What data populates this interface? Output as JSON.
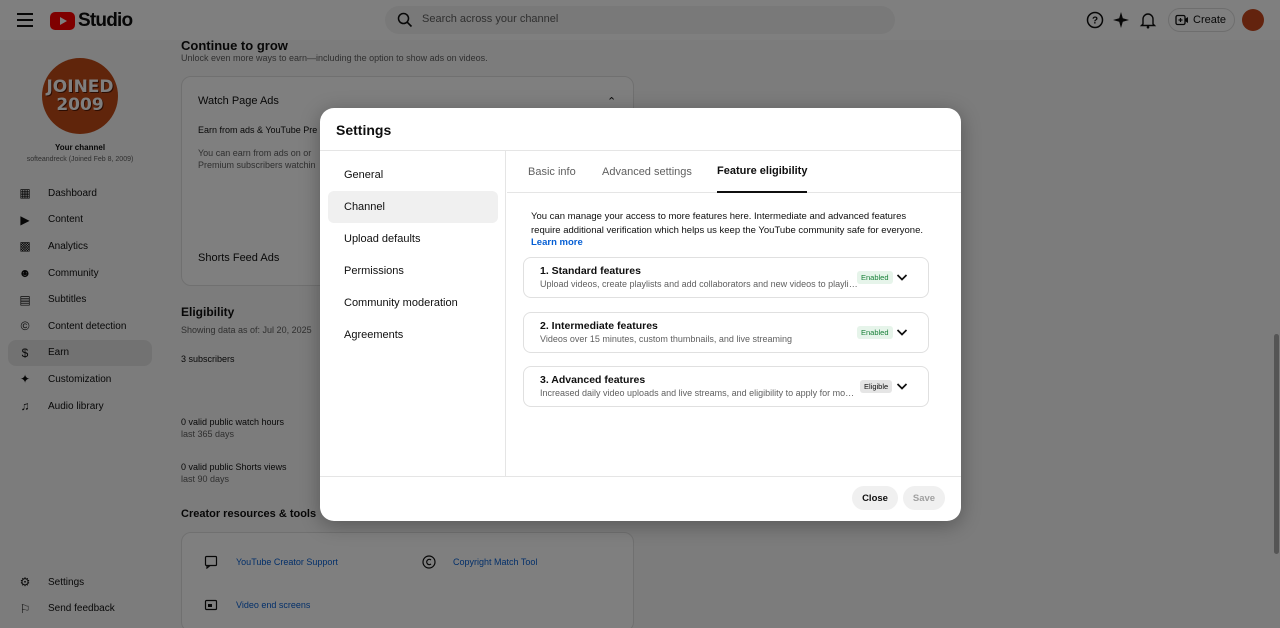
{
  "app": {
    "logo_text": "Studio",
    "search_placeholder": "Search across your channel",
    "create_label": "Create"
  },
  "channel": {
    "avatar_line1": "JOINED",
    "avatar_line2": "2009",
    "your_channel": "Your channel",
    "subtitle": "softeandreck (Joined Feb 8, 2009)"
  },
  "sidebar": {
    "items": [
      {
        "label": "Dashboard",
        "icon": "dashboard-icon"
      },
      {
        "label": "Content",
        "icon": "content-icon"
      },
      {
        "label": "Analytics",
        "icon": "analytics-icon"
      },
      {
        "label": "Community",
        "icon": "community-icon"
      },
      {
        "label": "Subtitles",
        "icon": "subtitles-icon"
      },
      {
        "label": "Content detection",
        "icon": "copyright-icon"
      },
      {
        "label": "Earn",
        "icon": "dollar-icon"
      },
      {
        "label": "Customization",
        "icon": "magic-wand-icon"
      },
      {
        "label": "Audio library",
        "icon": "audio-library-icon"
      }
    ],
    "bottom": [
      {
        "label": "Settings",
        "icon": "gear-icon"
      },
      {
        "label": "Send feedback",
        "icon": "feedback-icon"
      }
    ]
  },
  "background": {
    "heading": "Continue to grow",
    "subheading": "Unlock even more ways to earn—including the option to show ads on videos.",
    "card_title": "Watch Page Ads",
    "card_line1": "Earn from ads & YouTube Pre",
    "card_line2": "You can earn from ads on or Premium subscribers watchin",
    "shorts_title": "Shorts Feed Ads",
    "eligibility": "Eligibility",
    "showing": "Showing data as of: Jul 20, 2025",
    "subscribers": "3 subscribers",
    "watch_hours": "0 valid public watch hours",
    "watch_period": "last 365 days",
    "shorts_views": "0 valid public Shorts views",
    "shorts_period": "last 90 days",
    "resources_title": "Creator resources & tools",
    "link1": "YouTube Creator Support",
    "link2": "Copyright Match Tool",
    "link3": "Video end screens"
  },
  "dialog": {
    "title": "Settings",
    "nav": [
      {
        "label": "General",
        "active": false
      },
      {
        "label": "Channel",
        "active": true
      },
      {
        "label": "Upload defaults",
        "active": false
      },
      {
        "label": "Permissions",
        "active": false
      },
      {
        "label": "Community moderation",
        "active": false
      },
      {
        "label": "Agreements",
        "active": false
      }
    ],
    "tabs": [
      {
        "label": "Basic info",
        "active": false
      },
      {
        "label": "Advanced settings",
        "active": false
      },
      {
        "label": "Feature eligibility",
        "active": true
      }
    ],
    "intro": "You can manage your access to more features here. Intermediate and advanced features require additional verification which helps us keep the YouTube community safe for everyone.",
    "learn_more": "Learn more",
    "features": [
      {
        "title": "1. Standard features",
        "desc": "Upload videos, create playlists and add collaborators and new videos to playlists",
        "status": "Enabled"
      },
      {
        "title": "2. Intermediate features",
        "desc": "Videos over 15 minutes, custom thumbnails, and live streaming",
        "status": "Enabled"
      },
      {
        "title": "3. Advanced features",
        "desc": "Increased daily video uploads and live streams, and eligibility to apply for monetization",
        "status": "Eligible"
      }
    ],
    "close_label": "Close",
    "save_label": "Save"
  },
  "colors": {
    "brand_red": "#ff0000",
    "link_blue": "#065fd4",
    "enabled_green": "#188038"
  }
}
